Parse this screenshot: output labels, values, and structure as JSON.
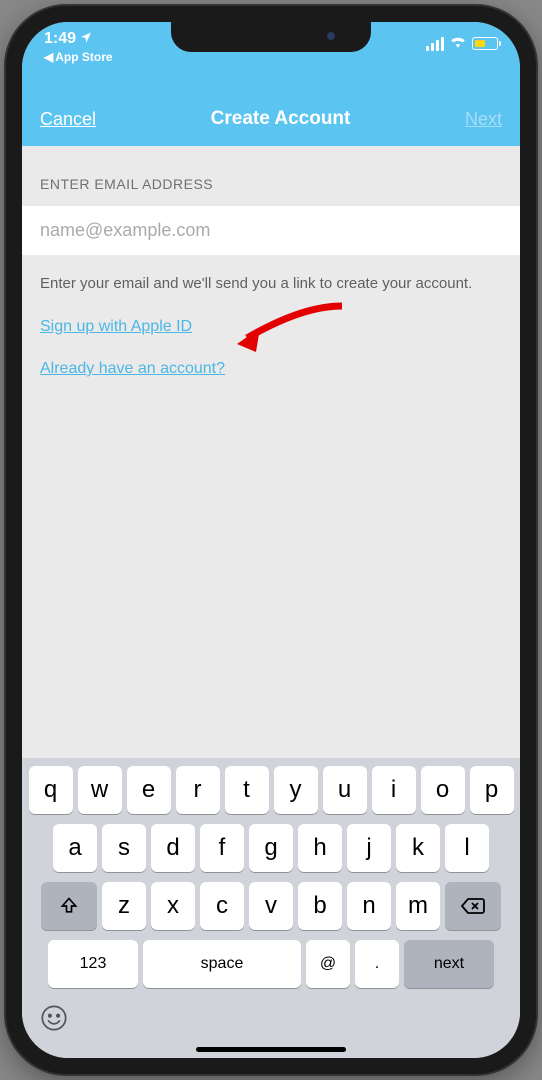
{
  "statusBar": {
    "time": "1:49",
    "backLabel": "App Store"
  },
  "navBar": {
    "cancel": "Cancel",
    "title": "Create Account",
    "next": "Next"
  },
  "form": {
    "sectionHeader": "ENTER EMAIL ADDRESS",
    "placeholder": "name@example.com",
    "value": "",
    "hint": "Enter your email and we'll send you a link to create your account.",
    "appleIdLink": "Sign up with Apple ID",
    "existingAccountLink": "Already have an account?"
  },
  "keyboard": {
    "row1": [
      "q",
      "w",
      "e",
      "r",
      "t",
      "y",
      "u",
      "i",
      "o",
      "p"
    ],
    "row2": [
      "a",
      "s",
      "d",
      "f",
      "g",
      "h",
      "j",
      "k",
      "l"
    ],
    "row3": [
      "z",
      "x",
      "c",
      "v",
      "b",
      "n",
      "m"
    ],
    "numKey": "123",
    "spaceKey": "space",
    "atKey": "@",
    "dotKey": ".",
    "nextKey": "next"
  }
}
